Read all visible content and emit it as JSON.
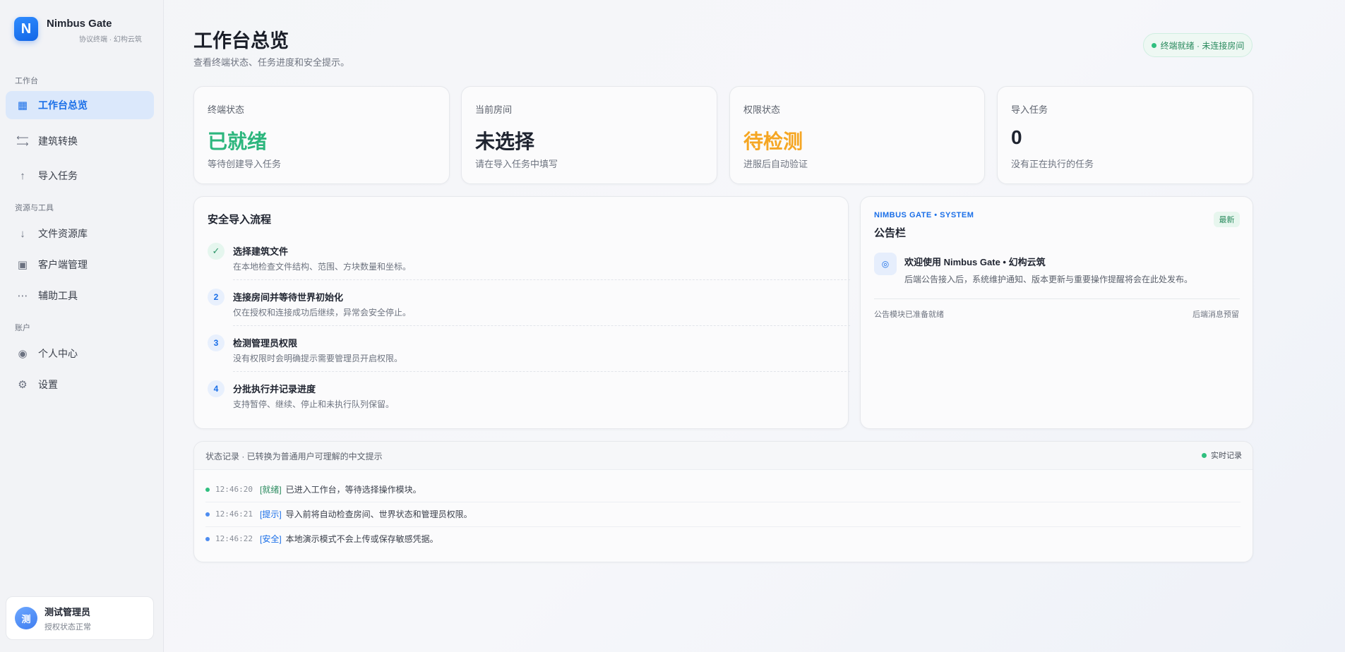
{
  "brand": {
    "logo_letter": "N",
    "name": "Nimbus Gate",
    "subtitle": "协议终端 · 幻构云筑"
  },
  "sidebar": {
    "sections": [
      "工作台",
      "资源与工具",
      "账户"
    ],
    "items": [
      {
        "label": "工作台总览",
        "icon": "grid-icon",
        "active": true
      },
      {
        "label": "建筑转换",
        "icon": "swap-arrows-icon",
        "active": false
      },
      {
        "label": "导入任务",
        "icon": "upload-arrow-icon",
        "active": false
      },
      {
        "label": "文件资源库",
        "icon": "download-arrow-icon",
        "active": false
      },
      {
        "label": "客户端管理",
        "icon": "square-box-icon",
        "active": false
      },
      {
        "label": "辅助工具",
        "icon": "more-dots-icon",
        "active": false
      },
      {
        "label": "个人中心",
        "icon": "user-circle-icon",
        "active": false
      },
      {
        "label": "设置",
        "icon": "gear-icon",
        "active": false
      }
    ]
  },
  "user": {
    "avatar_letter": "测",
    "name": "测试管理员",
    "status": "授权状态正常"
  },
  "header": {
    "title": "工作台总览",
    "subtitle": "查看终端状态、任务进度和安全提示。",
    "status_pill": "终端就绪 · 未连接房间"
  },
  "stats": [
    {
      "label": "终端状态",
      "value": "已就绪",
      "note": "等待创建导入任务",
      "color": "#2cb67d"
    },
    {
      "label": "当前房间",
      "value": "未选择",
      "note": "请在导入任务中填写",
      "color": "#1f2430"
    },
    {
      "label": "权限状态",
      "value": "待检测",
      "note": "进服后自动验证",
      "color": "#f5a623"
    },
    {
      "label": "导入任务",
      "value": "0",
      "note": "没有正在执行的任务",
      "color": "#1f2430"
    }
  ],
  "flow": {
    "title": "安全导入流程",
    "steps": [
      {
        "badge": "✓",
        "title": "选择建筑文件",
        "desc": "在本地检查文件结构、范围、方块数量和坐标。"
      },
      {
        "badge": "2",
        "title": "连接房间并等待世界初始化",
        "desc": "仅在授权和连接成功后继续，异常会安全停止。"
      },
      {
        "badge": "3",
        "title": "检测管理员权限",
        "desc": "没有权限时会明确提示需要管理员开启权限。"
      },
      {
        "badge": "4",
        "title": "分批执行并记录进度",
        "desc": "支持暂停、继续、停止和未执行队列保留。"
      }
    ]
  },
  "notice": {
    "kicker": "NIMBUS GATE • SYSTEM",
    "title": "公告栏",
    "tag": "最新",
    "icon_glyph": "◎",
    "headline": "欢迎使用 Nimbus Gate • 幻构云筑",
    "body": "后端公告接入后，系统维护通知、版本更新与重要操作提醒将会在此处发布。",
    "footer_left": "公告模块已准备就绪",
    "footer_right": "后端消息预留"
  },
  "log": {
    "header": "状态记录 · 已转换为普通用户可理解的中文提示",
    "live_label": "实时记录",
    "rows": [
      {
        "time": "12:46:20",
        "tag": "[就绪]",
        "msg": "已进入工作台，等待选择操作模块。",
        "kind": "ok"
      },
      {
        "time": "12:46:21",
        "tag": "[提示]",
        "msg": "导入前将自动检查房间、世界状态和管理员权限。",
        "kind": "info"
      },
      {
        "time": "12:46:22",
        "tag": "[安全]",
        "msg": "本地演示模式不会上传或保存敏感凭据。",
        "kind": "info"
      }
    ]
  }
}
